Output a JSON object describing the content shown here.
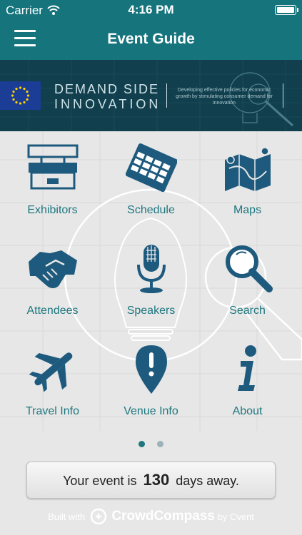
{
  "status_bar": {
    "carrier": "Carrier",
    "time": "4:16 PM",
    "battery_level": 1.0
  },
  "nav": {
    "title": "Event Guide",
    "menu_icon": "hamburger-menu-icon"
  },
  "banner": {
    "title_line1": "DEMAND SIDE",
    "title_line2": "INNOVATION",
    "tagline": "Developing effective policies for economic growth by stimulating consumer demand for innovation"
  },
  "tiles": [
    {
      "label": "Exhibitors",
      "icon": "exhibitor-booth-icon"
    },
    {
      "label": "Schedule",
      "icon": "calendar-icon"
    },
    {
      "label": "Maps",
      "icon": "map-icon"
    },
    {
      "label": "Attendees",
      "icon": "handshake-icon"
    },
    {
      "label": "Speakers",
      "icon": "microphone-icon"
    },
    {
      "label": "Search",
      "icon": "magnifier-icon"
    },
    {
      "label": "Travel Info",
      "icon": "airplane-icon"
    },
    {
      "label": "Venue Info",
      "icon": "map-pin-icon"
    },
    {
      "label": "About",
      "icon": "info-icon"
    }
  ],
  "pager": {
    "pages": 2,
    "active": 0
  },
  "countdown": {
    "prefix": "Your event is",
    "days": "130",
    "suffix": "days away."
  },
  "footer": {
    "built_with": "Built with",
    "brand": "CrowdCompass",
    "by": "by Cvent"
  },
  "colors": {
    "brand_teal": "#15747c",
    "icon_blue": "#1e5a7d",
    "label_teal": "#1f7780",
    "banner_bg": "#123f4d"
  }
}
